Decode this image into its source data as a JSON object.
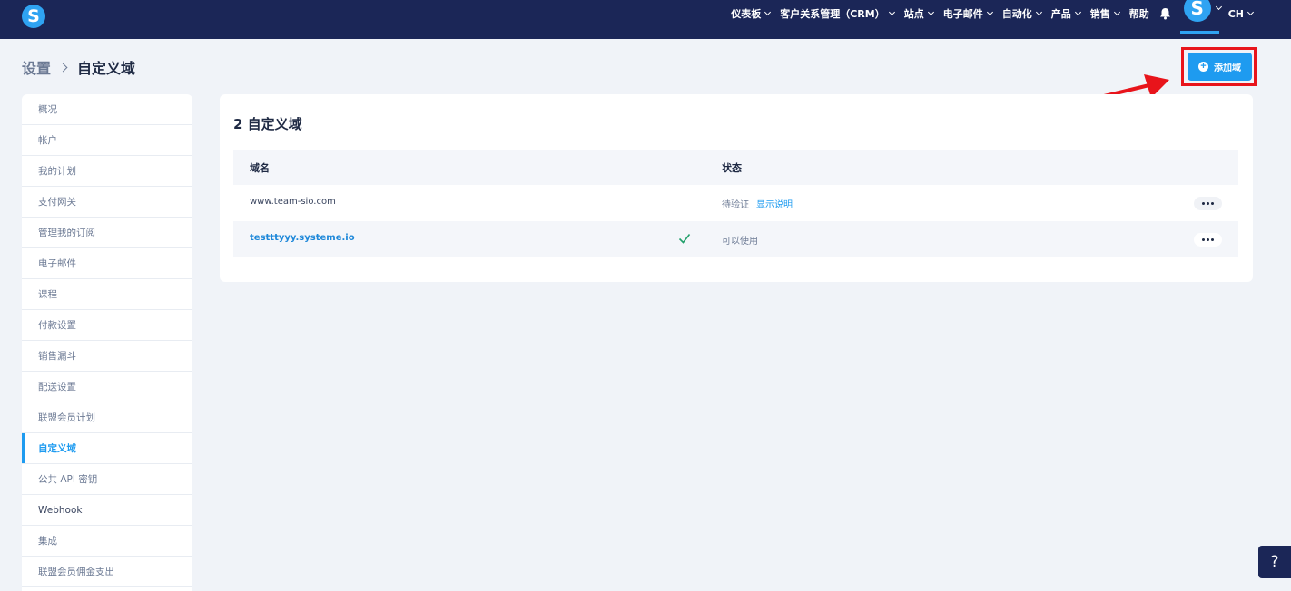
{
  "app": {
    "logo_letter": "S",
    "avatar_letter": "S",
    "accent_color": "#1e9bf0",
    "nav_bg_color": "#1b2657",
    "highlight_color": "#e8141b"
  },
  "nav": {
    "items": [
      {
        "label": "仪表板",
        "has_dropdown": true
      },
      {
        "label": "客户关系管理（CRM）",
        "has_dropdown": true
      },
      {
        "label": "站点",
        "has_dropdown": true
      },
      {
        "label": "电子邮件",
        "has_dropdown": true
      },
      {
        "label": "自动化",
        "has_dropdown": true
      },
      {
        "label": "产品",
        "has_dropdown": true
      },
      {
        "label": "销售",
        "has_dropdown": true
      },
      {
        "label": "帮助",
        "has_dropdown": false
      }
    ],
    "language": "CH",
    "icons": [
      "bell-icon",
      "chevron-down-icon"
    ]
  },
  "breadcrumb": {
    "parent": "设置",
    "current": "自定义域"
  },
  "add_button": {
    "label": "添加域",
    "icon": "plus-circle-icon"
  },
  "sidebar": {
    "items": [
      {
        "label": "概况",
        "active": false
      },
      {
        "label": "帐户",
        "active": false
      },
      {
        "label": "我的计划",
        "active": false
      },
      {
        "label": "支付网关",
        "active": false
      },
      {
        "label": "管理我的订阅",
        "active": false
      },
      {
        "label": "电子邮件",
        "active": false
      },
      {
        "label": "课程",
        "active": false
      },
      {
        "label": "付款设置",
        "active": false
      },
      {
        "label": "销售漏斗",
        "active": false
      },
      {
        "label": "配送设置",
        "active": false
      },
      {
        "label": "联盟会员计划",
        "active": false
      },
      {
        "label": "自定义域",
        "active": true
      },
      {
        "label": "公共 API 密钥",
        "active": false
      },
      {
        "label": "Webhook",
        "active": false
      },
      {
        "label": "集成",
        "active": false
      },
      {
        "label": "联盟会员佣金支出",
        "active": false
      }
    ]
  },
  "main": {
    "title": "2 自定义域",
    "table": {
      "headers": {
        "domain": "域名",
        "status": "状态"
      },
      "rows": [
        {
          "domain": "www.team-sio.com",
          "verified": false,
          "status": "待验证",
          "status_link": "显示说明"
        },
        {
          "domain": "testttyyy.systeme.io",
          "verified": true,
          "status": "可以使用",
          "status_link": ""
        }
      ]
    }
  },
  "help_button": {
    "label": "?"
  }
}
